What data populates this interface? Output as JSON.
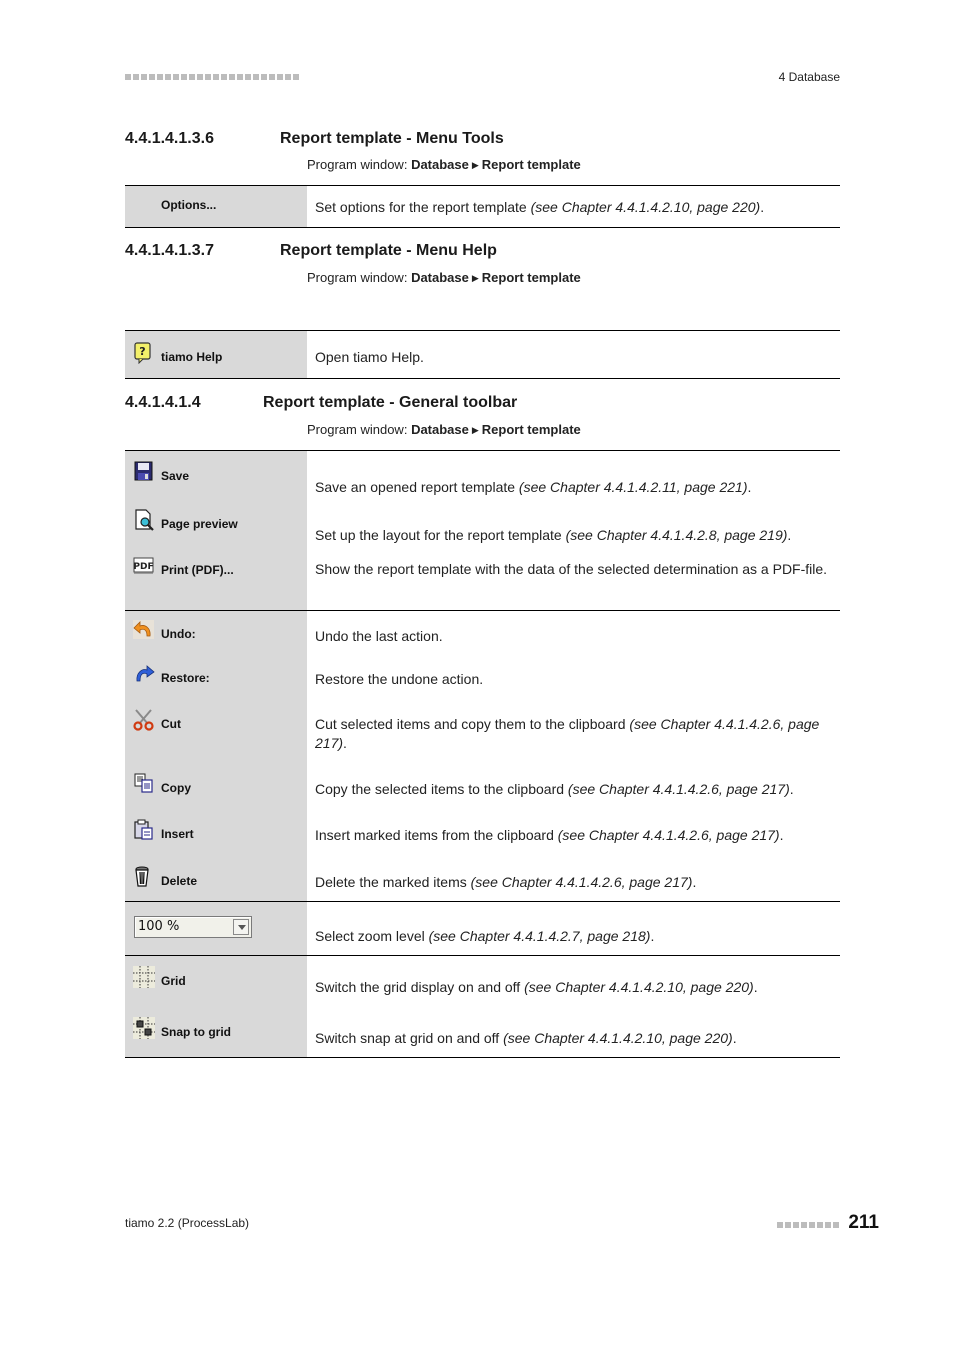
{
  "header": {
    "chapter": "4 Database"
  },
  "sections": [
    {
      "number": "4.4.1.4.1.3.6",
      "title": "Report template - Menu Tools",
      "program_window": {
        "prefix": "Program window:",
        "path1": "Database",
        "path2": "Report template"
      },
      "rows": [
        {
          "label": "Options...",
          "icon": null,
          "desc": "Set options for the report template ",
          "ref": "(see Chapter 4.4.1.4.2.10, page 220)",
          "end": "."
        }
      ]
    },
    {
      "number": "4.4.1.4.1.3.7",
      "title": "Report template - Menu Help",
      "program_window": {
        "prefix": "Program window:",
        "path1": "Database",
        "path2": "Report template"
      },
      "rows": [
        {
          "label": "tiamo Help",
          "icon": "help-icon",
          "desc": "Open tiamo Help.",
          "ref": "",
          "end": ""
        }
      ]
    },
    {
      "number": "4.4.1.4.1.4",
      "title": "Report template - General toolbar",
      "program_window": {
        "prefix": "Program window:",
        "path1": "Database",
        "path2": "Report template"
      },
      "rows": [
        {
          "label": "Save",
          "icon": "save-icon",
          "desc": "Save an opened report template ",
          "ref": "(see Chapter 4.4.1.4.2.11, page 221)",
          "end": "."
        },
        {
          "label": "Page preview",
          "icon": "page-preview-icon",
          "desc": "Set up the layout for the report template ",
          "ref": "(see Chapter 4.4.1.4.2.8, page 219)",
          "end": "."
        },
        {
          "label": "Print (PDF)...",
          "icon": "pdf-icon",
          "desc": "Show the report template with the data of the selected determination as a PDF-file.",
          "ref": "",
          "end": ""
        },
        {
          "label": "Undo:",
          "icon": "undo-icon",
          "desc": "Undo the last action.",
          "ref": "",
          "end": ""
        },
        {
          "label": "Restore:",
          "icon": "redo-icon",
          "desc": "Restore the undone action.",
          "ref": "",
          "end": ""
        },
        {
          "label": "Cut",
          "icon": "scissors-icon",
          "desc": "Cut selected items and copy them to the clipboard ",
          "ref": "(see Chapter 4.4.1.4.2.6, page 217)",
          "end": "."
        },
        {
          "label": "Copy",
          "icon": "copy-icon",
          "desc": "Copy the selected items to the clipboard ",
          "ref": "(see Chapter 4.4.1.4.2.6, page 217)",
          "end": "."
        },
        {
          "label": "Insert",
          "icon": "paste-icon",
          "desc": "Insert marked items from the clipboard ",
          "ref": "(see Chapter 4.4.1.4.2.6, page 217)",
          "end": "."
        },
        {
          "label": "Delete",
          "icon": "trash-icon",
          "desc": "Delete the marked items ",
          "ref": "(see Chapter 4.4.1.4.2.6, page 217)",
          "end": "."
        },
        {
          "label": "",
          "icon": "zoom-combobox",
          "combo_value": "100 %",
          "desc": "Select zoom level ",
          "ref": "(see Chapter 4.4.1.4.2.7, page 218)",
          "end": "."
        },
        {
          "label": "Grid",
          "icon": "grid-icon",
          "desc": "Switch the grid display on and off ",
          "ref": "(see Chapter 4.4.1.4.2.10, page 220)",
          "end": "."
        },
        {
          "label": "Snap to grid",
          "icon": "snap-to-grid-icon",
          "desc": "Switch snap at grid on and off ",
          "ref": "(see Chapter 4.4.1.4.2.10, page 220)",
          "end": "."
        }
      ]
    }
  ],
  "footer": {
    "product": "tiamo 2.2 (ProcessLab)",
    "page_number": "211"
  }
}
